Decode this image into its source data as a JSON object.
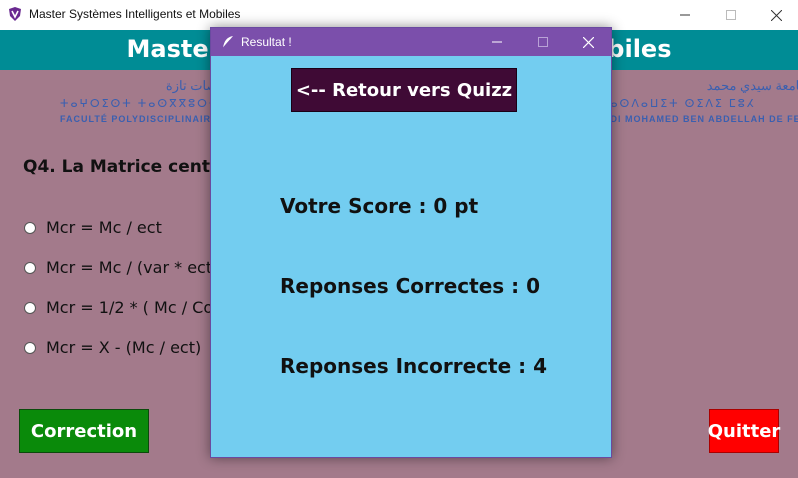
{
  "main_window": {
    "title": "Master Systèmes Intelligents et Mobiles",
    "banner_text": "Master Systèmes Intelligents et Mobiles",
    "logo_left": {
      "arabic": "التخصصات تازة",
      "tifinagh": "ⵜⴰⵖⵔⵉⵙⵜ ⵜⴰⵙⴳⴳⵓⵔⵜ",
      "latin": "FACULTÉ POLYDISCIPLINAIRE TAZA"
    },
    "logo_right": {
      "arabic": "جامعة سيدي محمد",
      "tifinagh": "ⵜⴰⵙⴷⴰⵡⵉⵜ ⵙⵉⴷⵉ ⵎⵓⵃ",
      "latin": "SIDI MOHAMED BEN ABDELLAH DE FES"
    },
    "question": "Q4. La Matrice centrée réduite",
    "options": [
      "Mcr = Mc / ect",
      "Mcr = Mc / (var * ect)",
      "Mcr =  1/2 * ( Mc / Cov )",
      "Mcr = X - (Mc / ect)"
    ],
    "correction_label": "Correction",
    "quit_label": "Quitter"
  },
  "dialog": {
    "title": "Resultat !",
    "back_label": "<-- Retour vers Quizz",
    "score": "Votre Score : 0 pt",
    "correct": "Reponses Correctes : 0",
    "incorrect": "Reponses Incorrecte : 4"
  },
  "colors": {
    "background": "#a37a8b",
    "banner": "#008c95",
    "dialog_bg": "#73cdf0",
    "dialog_titlebar": "#7b4fab",
    "retour_button": "#3f0a35",
    "correction_button": "#0a8a0a",
    "quit_button": "#ff0000"
  },
  "icons": {
    "app": "app-shield-icon",
    "dialog": "feather-icon"
  }
}
